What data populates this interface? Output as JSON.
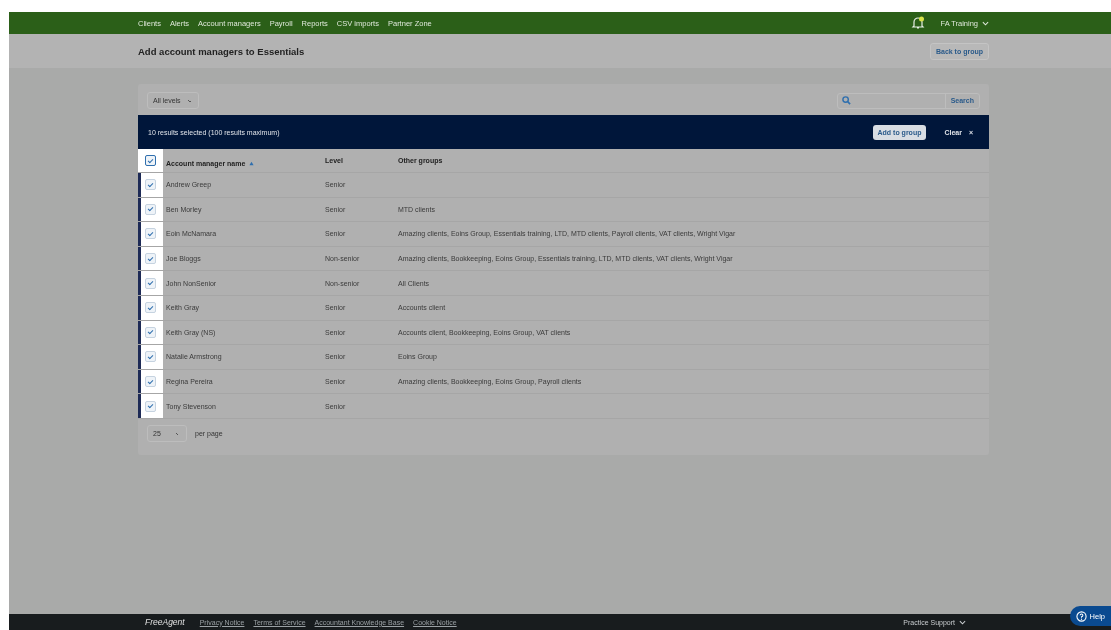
{
  "nav": {
    "items": [
      "Clients",
      "Alerts",
      "Account managers",
      "Payroll",
      "Reports",
      "CSV imports",
      "Partner Zone"
    ],
    "notification": true,
    "account": "FA Training"
  },
  "header": {
    "title": "Add account managers to Essentials",
    "back_button": "Back to group"
  },
  "filters": {
    "level_select": "All levels",
    "search_button": "Search"
  },
  "selection_bar": {
    "text": "10 results selected (100 results maximum)",
    "add_button": "Add to group",
    "clear_button": "Clear",
    "clear_icon": "×"
  },
  "table": {
    "all_checked": true,
    "columns": [
      "Account manager name",
      "Level",
      "Other groups"
    ],
    "rows": [
      {
        "name": "Andrew Greep",
        "level": "Senior",
        "groups": "",
        "checked": true
      },
      {
        "name": "Ben Morley",
        "level": "Senior",
        "groups": "MTD clients",
        "checked": true
      },
      {
        "name": "Eoin McNamara",
        "level": "Senior",
        "groups": "Amazing clients, Eoins Group, Essentials training, LTD, MTD clients, Payroll clients, VAT clients, Wright Vigar",
        "checked": true
      },
      {
        "name": "Joe Bloggs",
        "level": "Non-senior",
        "groups": "Amazing clients, Bookkeeping, Eoins Group, Essentials training, LTD, MTD clients, VAT clients, Wright Vigar",
        "checked": true
      },
      {
        "name": "John NonSenior",
        "level": "Non-senior",
        "groups": "All Clients",
        "checked": true
      },
      {
        "name": "Keith Gray",
        "level": "Senior",
        "groups": "Accounts client",
        "checked": true
      },
      {
        "name": "Keith Gray (NS)",
        "level": "Senior",
        "groups": "Accounts client, Bookkeeping, Eoins Group, VAT clients",
        "checked": true
      },
      {
        "name": "Natalie Armstrong",
        "level": "Senior",
        "groups": "Eoins Group",
        "checked": true
      },
      {
        "name": "Regina Pereira",
        "level": "Senior",
        "groups": "Amazing clients, Bookkeeping, Eoins Group, Payroll clients",
        "checked": true
      },
      {
        "name": "Tony Stevenson",
        "level": "Senior",
        "groups": "",
        "checked": true
      }
    ]
  },
  "pagination": {
    "per_page_value": "25",
    "per_page_label": "per page"
  },
  "footer": {
    "logo": "FreeAgent",
    "links": [
      "Privacy Notice",
      "Terms of Service",
      "Accountant Knowledge Base",
      "Cookie Notice"
    ],
    "support": "Practice Support",
    "help": "Help"
  }
}
